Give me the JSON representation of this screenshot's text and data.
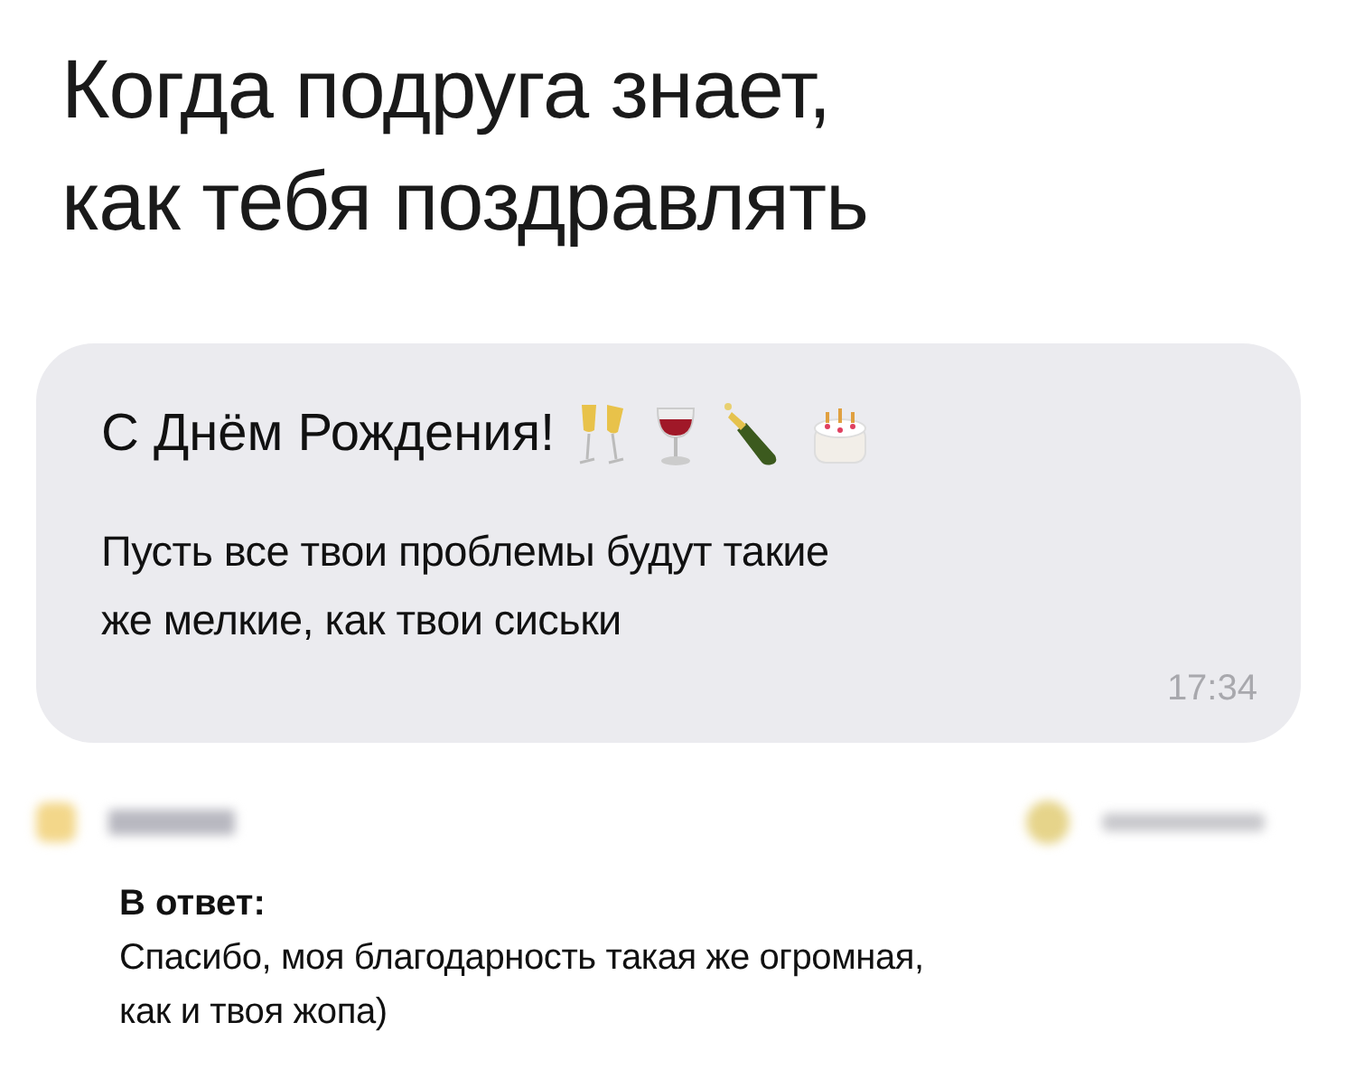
{
  "caption_lines": [
    "Когда подруга знает,",
    "как тебя поздравлять"
  ],
  "message": {
    "title": "С Днём Рождения!",
    "body_lines": [
      "Пусть все твои проблемы будут такие",
      "же мелкие, как твои сиськи"
    ],
    "time": "17:34"
  },
  "reply": {
    "label": "В ответ:",
    "text_lines": [
      "Спасибо, моя благодарность такая же огромная,",
      "как и твоя жопа)"
    ]
  }
}
